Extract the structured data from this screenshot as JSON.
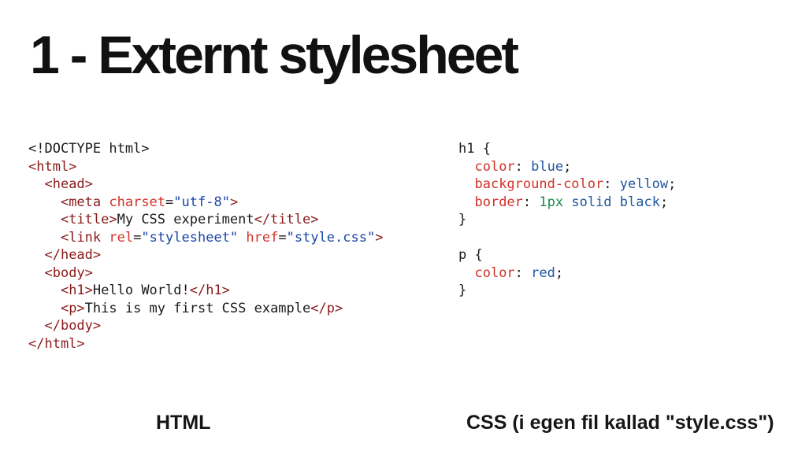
{
  "slide": {
    "title": "1 - Externt stylesheet"
  },
  "html_code": {
    "lines": [
      [
        {
          "t": "tok-text",
          "v": "<!DOCTYPE html>"
        }
      ],
      [
        {
          "t": "tok-tag",
          "v": "<html>"
        }
      ],
      [
        {
          "t": "tok-text",
          "v": "  "
        },
        {
          "t": "tok-tag",
          "v": "<head>"
        }
      ],
      [
        {
          "t": "tok-text",
          "v": "    "
        },
        {
          "t": "tok-tag",
          "v": "<meta "
        },
        {
          "t": "tok-attr",
          "v": "charset"
        },
        {
          "t": "tok-punct",
          "v": "="
        },
        {
          "t": "tok-str",
          "v": "\"utf-8\""
        },
        {
          "t": "tok-tag",
          "v": ">"
        }
      ],
      [
        {
          "t": "tok-text",
          "v": "    "
        },
        {
          "t": "tok-tag",
          "v": "<title>"
        },
        {
          "t": "tok-text",
          "v": "My CSS experiment"
        },
        {
          "t": "tok-tag",
          "v": "</title>"
        }
      ],
      [
        {
          "t": "tok-text",
          "v": "    "
        },
        {
          "t": "tok-tag",
          "v": "<link "
        },
        {
          "t": "tok-attr",
          "v": "rel"
        },
        {
          "t": "tok-punct",
          "v": "="
        },
        {
          "t": "tok-str",
          "v": "\"stylesheet\""
        },
        {
          "t": "tok-text",
          "v": " "
        },
        {
          "t": "tok-attr",
          "v": "href"
        },
        {
          "t": "tok-punct",
          "v": "="
        },
        {
          "t": "tok-str",
          "v": "\"style.css\""
        },
        {
          "t": "tok-tag",
          "v": ">"
        }
      ],
      [
        {
          "t": "tok-text",
          "v": "  "
        },
        {
          "t": "tok-tag",
          "v": "</head>"
        }
      ],
      [
        {
          "t": "tok-text",
          "v": "  "
        },
        {
          "t": "tok-tag",
          "v": "<body>"
        }
      ],
      [
        {
          "t": "tok-text",
          "v": "    "
        },
        {
          "t": "tok-tag",
          "v": "<h1>"
        },
        {
          "t": "tok-text",
          "v": "Hello World!"
        },
        {
          "t": "tok-tag",
          "v": "</h1>"
        }
      ],
      [
        {
          "t": "tok-text",
          "v": "    "
        },
        {
          "t": "tok-tag",
          "v": "<p>"
        },
        {
          "t": "tok-text",
          "v": "This is my first CSS example"
        },
        {
          "t": "tok-tag",
          "v": "</p>"
        }
      ],
      [
        {
          "t": "tok-text",
          "v": "  "
        },
        {
          "t": "tok-tag",
          "v": "</body>"
        }
      ],
      [
        {
          "t": "tok-tag",
          "v": "</html>"
        }
      ]
    ]
  },
  "css_code": {
    "lines": [
      [
        {
          "t": "tok-sel",
          "v": "h1 {"
        }
      ],
      [
        {
          "t": "tok-text",
          "v": "  "
        },
        {
          "t": "tok-prop",
          "v": "color"
        },
        {
          "t": "tok-punct",
          "v": ": "
        },
        {
          "t": "tok-val",
          "v": "blue"
        },
        {
          "t": "tok-punct",
          "v": ";"
        }
      ],
      [
        {
          "t": "tok-text",
          "v": "  "
        },
        {
          "t": "tok-prop",
          "v": "background-color"
        },
        {
          "t": "tok-punct",
          "v": ": "
        },
        {
          "t": "tok-val",
          "v": "yellow"
        },
        {
          "t": "tok-punct",
          "v": ";"
        }
      ],
      [
        {
          "t": "tok-text",
          "v": "  "
        },
        {
          "t": "tok-prop",
          "v": "border"
        },
        {
          "t": "tok-punct",
          "v": ": "
        },
        {
          "t": "tok-num",
          "v": "1px"
        },
        {
          "t": "tok-text",
          "v": " "
        },
        {
          "t": "tok-val",
          "v": "solid"
        },
        {
          "t": "tok-text",
          "v": " "
        },
        {
          "t": "tok-val",
          "v": "black"
        },
        {
          "t": "tok-punct",
          "v": ";"
        }
      ],
      [
        {
          "t": "tok-sel",
          "v": "}"
        }
      ],
      [
        {
          "t": "tok-text",
          "v": ""
        }
      ],
      [
        {
          "t": "tok-sel",
          "v": "p {"
        }
      ],
      [
        {
          "t": "tok-text",
          "v": "  "
        },
        {
          "t": "tok-prop",
          "v": "color"
        },
        {
          "t": "tok-punct",
          "v": ": "
        },
        {
          "t": "tok-val",
          "v": "red"
        },
        {
          "t": "tok-punct",
          "v": ";"
        }
      ],
      [
        {
          "t": "tok-sel",
          "v": "}"
        }
      ]
    ]
  },
  "captions": {
    "html": "HTML",
    "css": "CSS (i egen fil kallad \"style.css\")"
  },
  "colors": {
    "background": "#ffffff",
    "title": "#111111",
    "tag": "#8b1a1a",
    "attribute": "#d23228",
    "string": "#1a46a8",
    "css_property": "#d23228",
    "css_value": "#1e56a0",
    "css_number": "#1f8a4c"
  }
}
